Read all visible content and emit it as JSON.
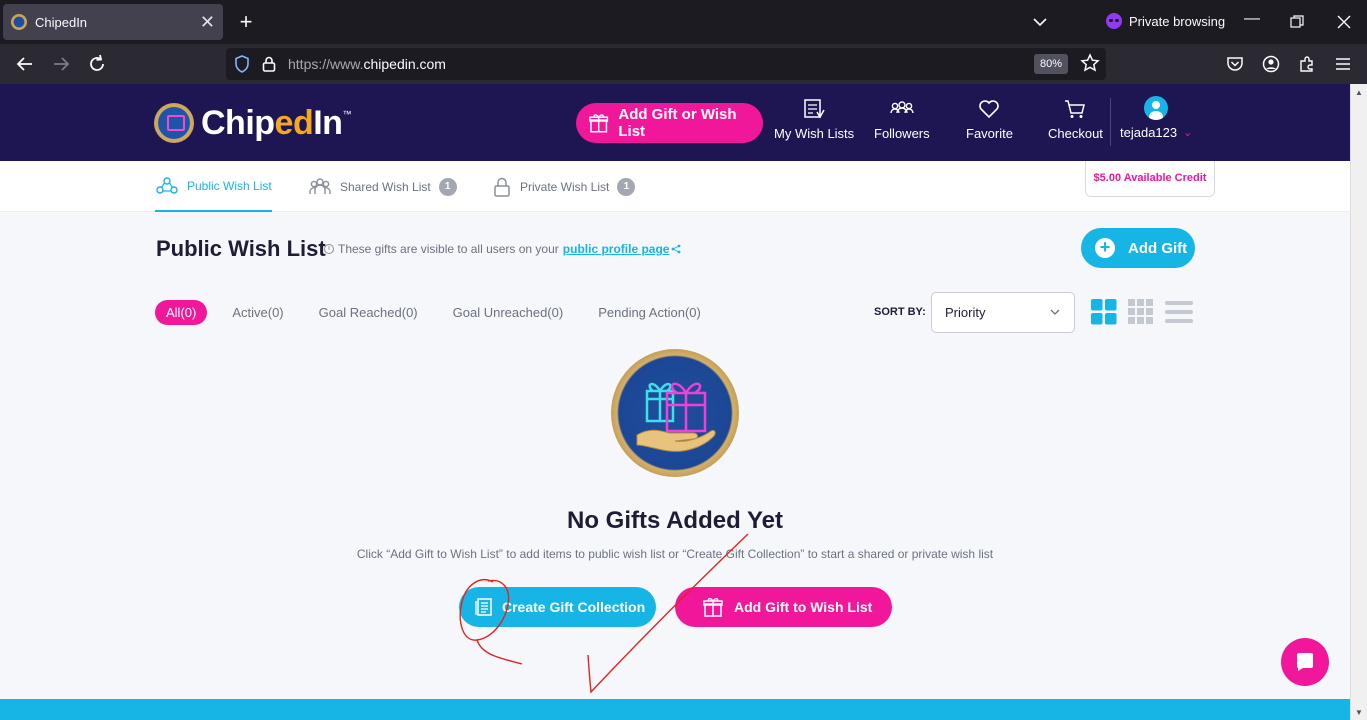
{
  "browser": {
    "tab_title": "ChipedIn",
    "tab_close": "✕",
    "new_tab": "+",
    "private_label": "Private browsing",
    "url_proto": "https://www.",
    "url_host": "chipedin.com",
    "zoom": "80%"
  },
  "header": {
    "logo_main": "Chip",
    "logo_accent": "ed",
    "logo_end": "In",
    "logo_tm": "™",
    "cta_label": "Add Gift or Wish List",
    "nav": {
      "my_wish_lists": "My Wish Lists",
      "followers": "Followers",
      "favorite": "Favorite",
      "checkout": "Checkout"
    },
    "username": "tejada123",
    "caret": "⌄"
  },
  "tabs": {
    "public": "Public Wish List",
    "shared": "Shared Wish List",
    "shared_count": "1",
    "private": "Private Wish List",
    "private_count": "1",
    "credit": "$5.00 Available Credit"
  },
  "content": {
    "title": "Public Wish List",
    "info_text": "These gifts are visible to all users on your",
    "profile_link": "public profile page",
    "add_gift": "Add Gift",
    "filters": {
      "all": "All(0)",
      "active": "Active(0)",
      "goal_reached": "Goal Reached(0)",
      "goal_unreached": "Goal Unreached(0)",
      "pending": "Pending Action(0)"
    },
    "sort_label": "SORT BY:",
    "sort_value": "Priority",
    "empty_title": "No Gifts Added Yet",
    "empty_desc": "Click “Add Gift to Wish List” to add items to public wish list or “Create Gift Collection” to start a shared or private wish list",
    "btn_collection": "Create Gift Collection",
    "btn_addgift": "Add Gift to Wish List"
  },
  "colors": {
    "brand_navy": "#1d1653",
    "brand_pink": "#f0179a",
    "brand_cyan": "#16b5e6",
    "annotation_red": "#e0241f"
  }
}
